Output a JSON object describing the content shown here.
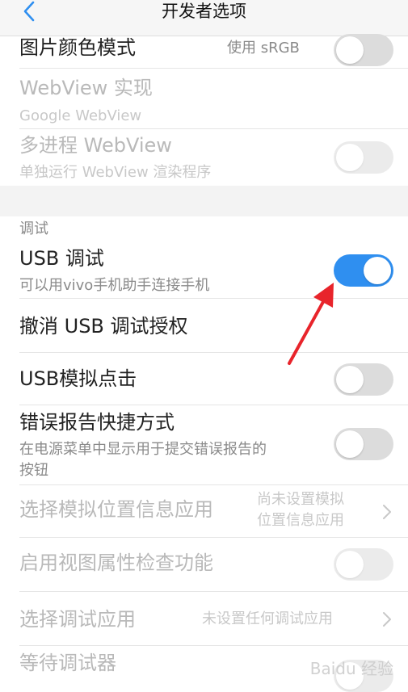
{
  "header": {
    "title": "开发者选项"
  },
  "rows": [
    {
      "main": "图片颜色模式",
      "value": "使用 sRGB",
      "toggle": "off"
    },
    {
      "main": "WebView 实现",
      "sub": "Google WebView"
    },
    {
      "main": "多进程 WebView",
      "sub": "单独运行 WebView 渲染程序",
      "toggle": "off"
    }
  ],
  "debug_section": {
    "label": "调试"
  },
  "debug_rows": [
    {
      "main": "USB 调试",
      "sub": "可以用vivo手机助手连接手机",
      "toggle": "on"
    },
    {
      "main": "撤消 USB 调试授权"
    },
    {
      "main": "USB模拟点击",
      "toggle": "off"
    },
    {
      "main": "错误报告快捷方式",
      "sub_line1": "在电源菜单中显示用于提交错误报告的",
      "sub_line2": "按钮",
      "toggle": "off"
    },
    {
      "main": "选择模拟位置信息应用",
      "value_line1": "尚未设置模拟",
      "value_line2": "位置信息应用"
    },
    {
      "main": "启用视图属性检查功能",
      "toggle": "off"
    },
    {
      "main": "选择调试应用",
      "value": "未设置任何调试应用"
    },
    {
      "main": "等待调试器"
    }
  ],
  "watermark": {
    "text": "Baidu 经验"
  },
  "colors": {
    "accent": "#2f8ff0",
    "annotation": "#e8242b"
  }
}
